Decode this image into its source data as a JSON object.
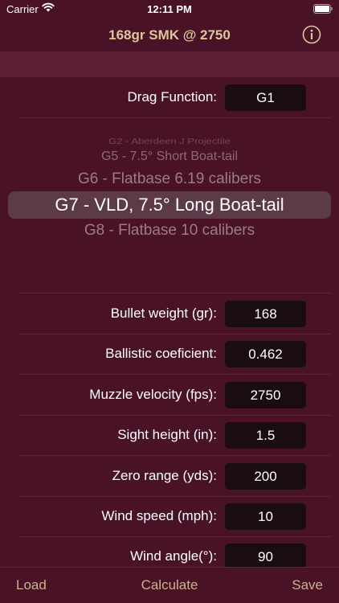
{
  "status": {
    "carrier": "Carrier",
    "time": "12:11 PM"
  },
  "nav": {
    "title": "168gr SMK @ 2750"
  },
  "drag": {
    "label": "Drag Function:",
    "value": "G1"
  },
  "picker": {
    "items": [
      "G2 - Aberdeen J Projectile",
      "G5 - 7.5° Short Boat-tail",
      "G6 - Flatbase 6.19 calibers",
      "G7 - VLD, 7.5° Long Boat-tail",
      "G8 - Flatbase 10 calibers"
    ],
    "selected_index": 3
  },
  "fields": [
    {
      "label": "Bullet weight (gr):",
      "value": "168"
    },
    {
      "label": "Ballistic coeficient:",
      "value": "0.462"
    },
    {
      "label": "Muzzle velocity (fps):",
      "value": "2750"
    },
    {
      "label": "Sight height (in):",
      "value": "1.5"
    },
    {
      "label": "Zero range (yds):",
      "value": "200"
    },
    {
      "label": "Wind speed (mph):",
      "value": "10"
    },
    {
      "label": "Wind angle(°):",
      "value": "90"
    }
  ],
  "toolbar": {
    "load": "Load",
    "calculate": "Calculate",
    "save": "Save"
  },
  "colors": {
    "background": "#4a1226",
    "accent": "#c9b48c",
    "field": "#1a0d12"
  }
}
